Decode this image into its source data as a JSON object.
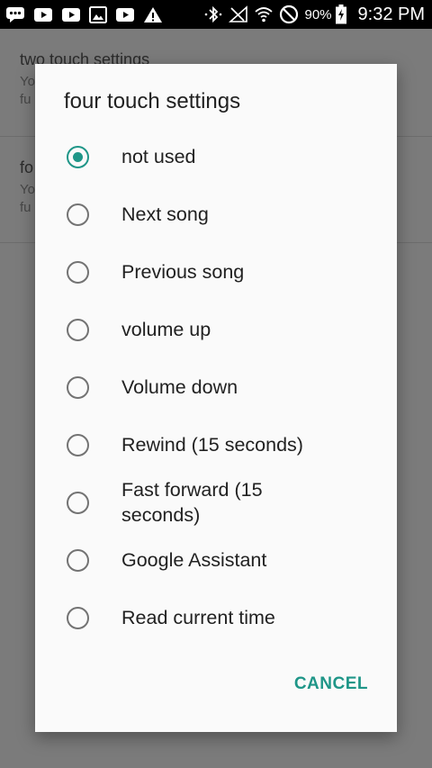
{
  "status_bar": {
    "icons": [
      "messages-icon",
      "youtube-icon",
      "youtube-icon",
      "image-icon",
      "youtube-icon",
      "warning-icon"
    ],
    "battery_percent": "90%",
    "time": "9:32 PM"
  },
  "background_settings": {
    "items": [
      {
        "title": "two touch settings",
        "summary_line1": "Yo",
        "summary_line2": "fu"
      },
      {
        "title": "fo",
        "summary_line1": "Yo",
        "summary_line2": "fu"
      }
    ]
  },
  "dialog": {
    "title": "four touch settings",
    "options": [
      {
        "label": "not used",
        "checked": true
      },
      {
        "label": "Next song",
        "checked": false
      },
      {
        "label": "Previous song",
        "checked": false
      },
      {
        "label": "volume up",
        "checked": false
      },
      {
        "label": "Volume down",
        "checked": false
      },
      {
        "label": "Rewind (15 seconds)",
        "checked": false
      },
      {
        "label": "Fast forward (15 seconds)",
        "checked": false
      },
      {
        "label": "Google Assistant",
        "checked": false
      },
      {
        "label": "Read current time",
        "checked": false
      }
    ],
    "cancel_label": "CANCEL"
  },
  "colors": {
    "accent": "#1f9688",
    "scrim": "#7a7a7a",
    "dialog_bg": "#fafafa"
  }
}
